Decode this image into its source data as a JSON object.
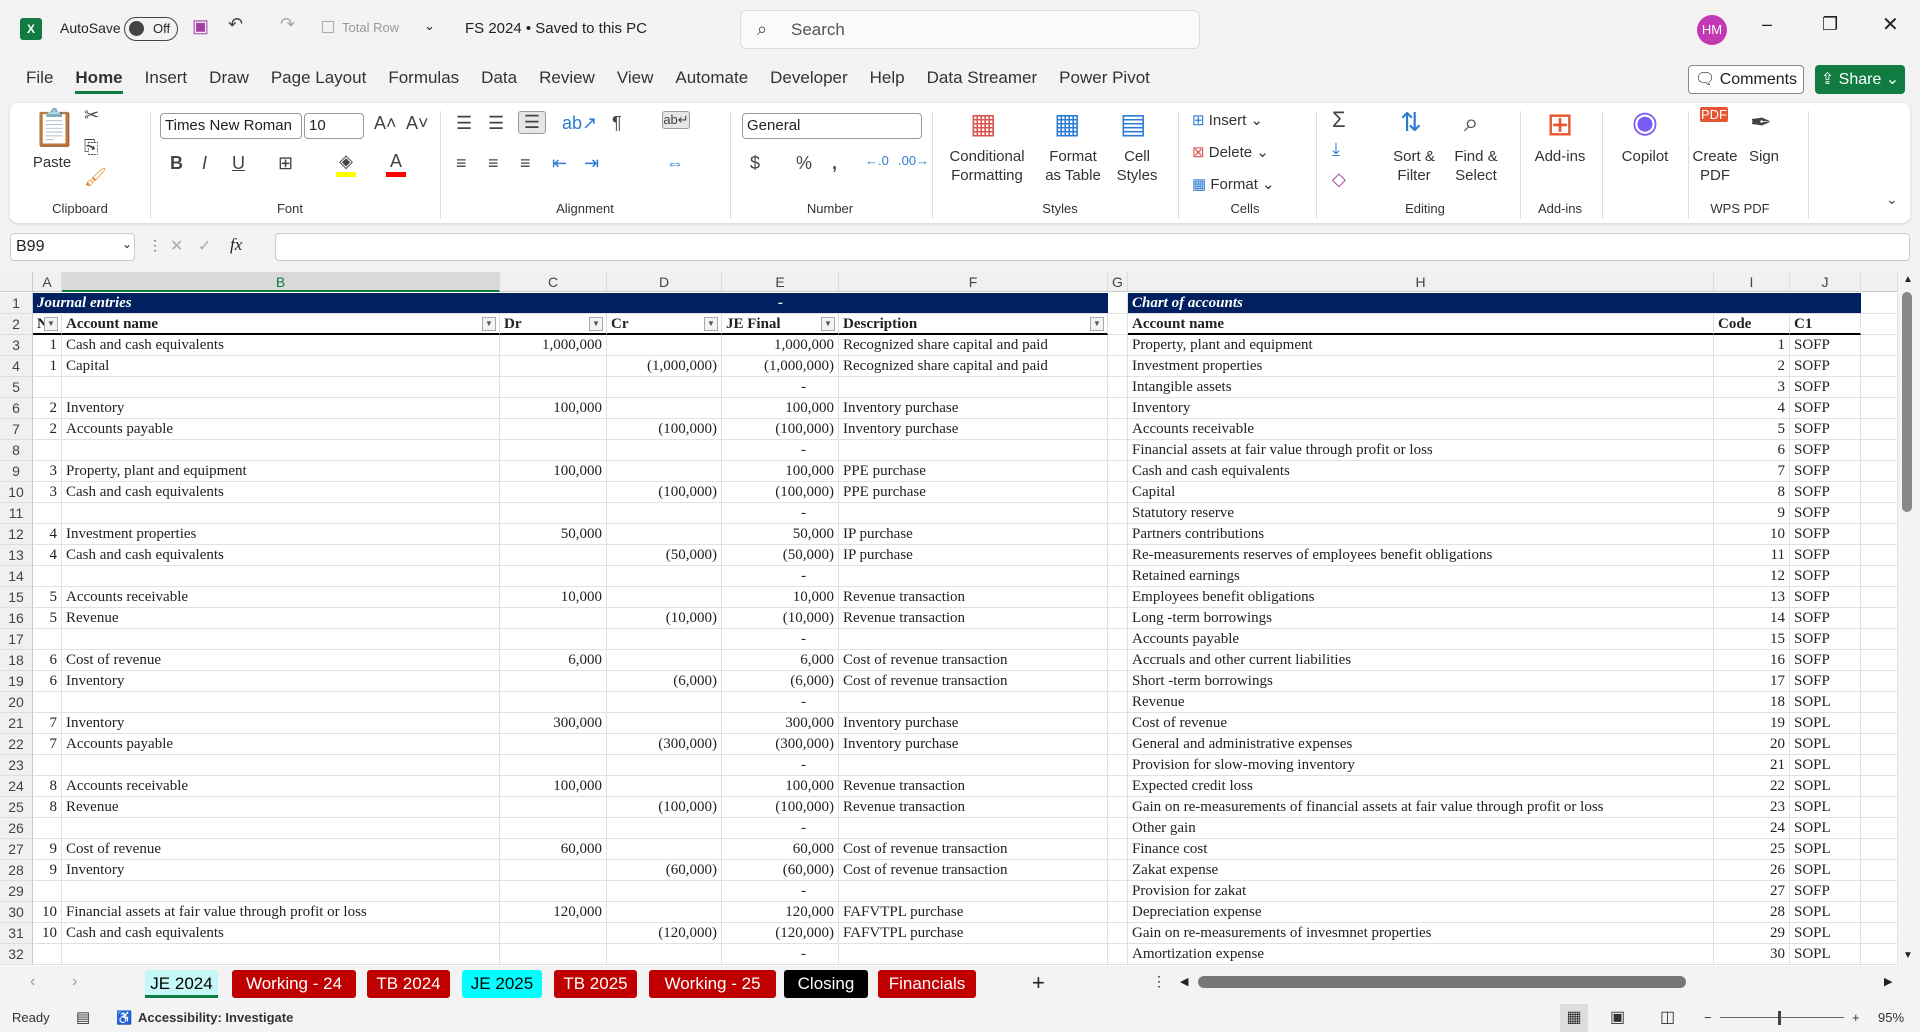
{
  "titlebar": {
    "app_icon": "excel-logo",
    "autosave_label": "AutoSave",
    "autosave_state": "Off",
    "total_row_label": "Total Row",
    "doc_title": "FS 2024 • Saved to this PC",
    "search_placeholder": "Search",
    "avatar_initials": "HM"
  },
  "menu": {
    "tabs": [
      "File",
      "Home",
      "Insert",
      "Draw",
      "Page Layout",
      "Formulas",
      "Data",
      "Review",
      "View",
      "Automate",
      "Developer",
      "Help",
      "Data Streamer",
      "Power Pivot"
    ],
    "active": "Home",
    "comments_label": "Comments",
    "share_label": "Share"
  },
  "ribbon": {
    "clipboard": {
      "paste": "Paste",
      "label": "Clipboard"
    },
    "font": {
      "name": "Times New Roman",
      "size": "10",
      "label": "Font",
      "fill_color": "#ffff00",
      "font_color": "#ff0000"
    },
    "alignment": {
      "label": "Alignment"
    },
    "number": {
      "format": "General",
      "label": "Number"
    },
    "styles": {
      "conditional": "Conditional Formatting",
      "format_table": "Format as Table",
      "cell_styles": "Cell Styles",
      "label": "Styles"
    },
    "cells": {
      "insert": "Insert",
      "delete": "Delete",
      "format": "Format",
      "label": "Cells"
    },
    "editing": {
      "sort": "Sort & Filter",
      "find": "Find & Select",
      "label": "Editing"
    },
    "addins": {
      "addins": "Add-ins",
      "label": "Add-ins"
    },
    "copilot": {
      "label": "Copilot"
    },
    "wps": {
      "create_pdf": "Create PDF",
      "sign": "Sign",
      "label": "WPS PDF"
    }
  },
  "formula_bar": {
    "name_box": "B99",
    "fx": "fx",
    "value": ""
  },
  "columns": [
    "A",
    "B",
    "C",
    "D",
    "E",
    "F",
    "G",
    "H",
    "I",
    "J"
  ],
  "selected_column": "B",
  "journal": {
    "title": "Journal entries",
    "title_dash": "-",
    "headers": [
      "N",
      "Account name",
      "Dr",
      "Cr",
      "JE Final",
      "Description"
    ],
    "rows": [
      [
        "1",
        "Cash and cash equivalents",
        "1,000,000",
        "",
        "1,000,000",
        "Recognized share capital  and paid"
      ],
      [
        "1",
        "Capital",
        "",
        "(1,000,000)",
        "(1,000,000)",
        "Recognized share capital  and paid"
      ],
      [
        "",
        "",
        "",
        "",
        "-",
        ""
      ],
      [
        "2",
        "Inventory",
        "100,000",
        "",
        "100,000",
        "Inventory purchase"
      ],
      [
        "2",
        "Accounts payable",
        "",
        "(100,000)",
        "(100,000)",
        "Inventory purchase"
      ],
      [
        "",
        "",
        "",
        "",
        "-",
        ""
      ],
      [
        "3",
        "Property, plant and equipment",
        "100,000",
        "",
        "100,000",
        "PPE purchase"
      ],
      [
        "3",
        "Cash and cash equivalents",
        "",
        "(100,000)",
        "(100,000)",
        "PPE purchase"
      ],
      [
        "",
        "",
        "",
        "",
        "-",
        ""
      ],
      [
        "4",
        "Investment properties",
        "50,000",
        "",
        "50,000",
        "IP purchase"
      ],
      [
        "4",
        "Cash and cash equivalents",
        "",
        "(50,000)",
        "(50,000)",
        "IP purchase"
      ],
      [
        "",
        "",
        "",
        "",
        "-",
        ""
      ],
      [
        "5",
        "Accounts receivable",
        "10,000",
        "",
        "10,000",
        "Revenue transaction"
      ],
      [
        "5",
        "Revenue",
        "",
        "(10,000)",
        "(10,000)",
        "Revenue transaction"
      ],
      [
        "",
        "",
        "",
        "",
        "-",
        ""
      ],
      [
        "6",
        "Cost of revenue",
        "6,000",
        "",
        "6,000",
        "Cost of revenue transaction"
      ],
      [
        "6",
        "Inventory",
        "",
        "(6,000)",
        "(6,000)",
        "Cost of revenue transaction"
      ],
      [
        "",
        "",
        "",
        "",
        "-",
        ""
      ],
      [
        "7",
        "Inventory",
        "300,000",
        "",
        "300,000",
        "Inventory purchase"
      ],
      [
        "7",
        "Accounts payable",
        "",
        "(300,000)",
        "(300,000)",
        "Inventory purchase"
      ],
      [
        "",
        "",
        "",
        "",
        "-",
        ""
      ],
      [
        "8",
        "Accounts receivable",
        "100,000",
        "",
        "100,000",
        "Revenue transaction"
      ],
      [
        "8",
        "Revenue",
        "",
        "(100,000)",
        "(100,000)",
        "Revenue transaction"
      ],
      [
        "",
        "",
        "",
        "",
        "-",
        ""
      ],
      [
        "9",
        "Cost of revenue",
        "60,000",
        "",
        "60,000",
        "Cost of revenue transaction"
      ],
      [
        "9",
        "Inventory",
        "",
        "(60,000)",
        "(60,000)",
        "Cost of revenue transaction"
      ],
      [
        "",
        "",
        "",
        "",
        "-",
        ""
      ],
      [
        "10",
        "Financial assets at fair value through profit or loss",
        "120,000",
        "",
        "120,000",
        "FAFVTPL purchase"
      ],
      [
        "10",
        "Cash and cash equivalents",
        "",
        "(120,000)",
        "(120,000)",
        "FAFVTPL purchase"
      ],
      [
        "",
        "",
        "",
        "",
        "-",
        ""
      ]
    ]
  },
  "chart_of_accounts": {
    "title": "Chart of accounts",
    "headers": [
      "Account name",
      "Code",
      "C1"
    ],
    "rows": [
      [
        "Property, plant and equipment",
        "1",
        "SOFP"
      ],
      [
        "Investment properties",
        "2",
        "SOFP"
      ],
      [
        "Intangible assets",
        "3",
        "SOFP"
      ],
      [
        "Inventory",
        "4",
        "SOFP"
      ],
      [
        "Accounts receivable",
        "5",
        "SOFP"
      ],
      [
        "Financial assets at fair value through profit or loss",
        "6",
        "SOFP"
      ],
      [
        "Cash and cash equivalents",
        "7",
        "SOFP"
      ],
      [
        "Capital",
        "8",
        "SOFP"
      ],
      [
        "Statutory reserve",
        "9",
        "SOFP"
      ],
      [
        "Partners contributions",
        "10",
        "SOFP"
      ],
      [
        "Re-measurements reserves of employees benefit obligations",
        "11",
        "SOFP"
      ],
      [
        "Retained earnings",
        "12",
        "SOFP"
      ],
      [
        "Employees benefit obligations",
        "13",
        "SOFP"
      ],
      [
        "Long -term borrowings",
        "14",
        "SOFP"
      ],
      [
        "Accounts payable",
        "15",
        "SOFP"
      ],
      [
        "Accruals and other current liabilities",
        "16",
        "SOFP"
      ],
      [
        "Short -term borrowings",
        "17",
        "SOFP"
      ],
      [
        "Revenue",
        "18",
        "SOPL"
      ],
      [
        "Cost of revenue",
        "19",
        "SOPL"
      ],
      [
        "General and administrative expenses",
        "20",
        "SOPL"
      ],
      [
        "Provision for slow-moving inventory",
        "21",
        "SOPL"
      ],
      [
        "Expected credit loss",
        "22",
        "SOPL"
      ],
      [
        "Gain on re-measurements of financial assets at fair value through profit or loss",
        "23",
        "SOPL"
      ],
      [
        "Other gain",
        "24",
        "SOPL"
      ],
      [
        "Finance cost",
        "25",
        "SOPL"
      ],
      [
        "Zakat expense",
        "26",
        "SOPL"
      ],
      [
        "Provision for zakat",
        "27",
        "SOFP"
      ],
      [
        "Depreciation expense",
        "28",
        "SOPL"
      ],
      [
        "Gain on re-measurements of invesmnet properties",
        "29",
        "SOPL"
      ],
      [
        "Amortization expense",
        "30",
        "SOPL"
      ]
    ]
  },
  "sheet_tabs": [
    {
      "label": "JE 2024",
      "color": "#c6f7f7",
      "active": true
    },
    {
      "label": "Working - 24",
      "color": "#c00000"
    },
    {
      "label": "TB 2024",
      "color": "#c00000"
    },
    {
      "label": "JE 2025",
      "color": "#00ffff"
    },
    {
      "label": "TB 2025",
      "color": "#c00000"
    },
    {
      "label": "Working - 25",
      "color": "#c00000"
    },
    {
      "label": "Closing",
      "color": "#000000"
    },
    {
      "label": "Financials",
      "color": "#c00000"
    }
  ],
  "status": {
    "ready": "Ready",
    "accessibility": "Accessibility: Investigate",
    "zoom": "95%"
  }
}
